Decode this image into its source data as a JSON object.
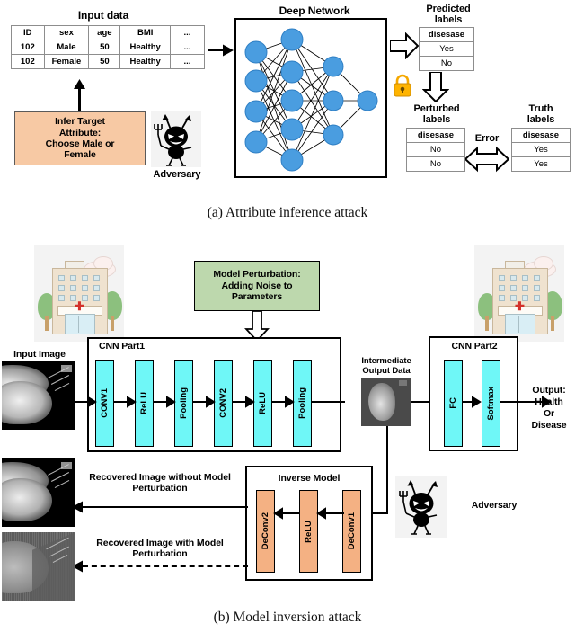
{
  "figure_a": {
    "caption": "(a) Attribute inference attack",
    "input_table": {
      "title": "Input data",
      "headers": [
        "ID",
        "sex",
        "age",
        "BMI",
        "..."
      ],
      "rows": [
        [
          "102",
          "Male",
          "50",
          "Healthy",
          "..."
        ],
        [
          "102",
          "Female",
          "50",
          "Healthy",
          "..."
        ]
      ],
      "highlight_color": "#ff0000"
    },
    "infer_box": {
      "line1": "Infer Target",
      "line2": "Attribute:",
      "line3": "Choose Male or",
      "line4": "Female",
      "fill": "#f7c9a4"
    },
    "adversary_label": "Adversary",
    "network": {
      "title": "Deep Network",
      "node_color": "#4a9de0",
      "layer_sizes": [
        4,
        5,
        3,
        1
      ]
    },
    "predicted": {
      "title_line1": "Predicted",
      "title_line2": "labels",
      "header": "disesase",
      "rows": [
        "Yes",
        "No"
      ]
    },
    "perturbed": {
      "title_line1": "Perturbed",
      "title_line2": "labels",
      "header": "disesase",
      "rows": [
        "No",
        "No"
      ]
    },
    "truth": {
      "title_line1": "Truth",
      "title_line2": "labels",
      "header": "disesase",
      "rows": [
        "Yes",
        "Yes"
      ]
    },
    "error_label": "Error",
    "lock_icon": "lock-icon"
  },
  "figure_b": {
    "caption": "(b) Model inversion attack",
    "hospital_a": "Hospital A",
    "hospital_b": "Hospital B",
    "perturbation_box": {
      "line1": "Model Perturbation:",
      "line2": "Adding Noise to",
      "line3": "Parameters",
      "fill": "#bdd8ad"
    },
    "input_image_label": "Input Image",
    "cnn_part1": {
      "title": "CNN Part1",
      "layers": [
        "CONV1",
        "ReLU",
        "Pooling",
        "CONV2",
        "ReLU",
        "Pooling"
      ],
      "fill": "#6ff7f7"
    },
    "intermediate": {
      "line1": "Intermediate",
      "line2": "Output Data"
    },
    "cnn_part2": {
      "title": "CNN Part2",
      "layers": [
        "FC",
        "Softmax"
      ],
      "fill": "#6ff7f7"
    },
    "output": {
      "line1": "Output:",
      "line2": "Health",
      "line3": "Or",
      "line4": "Disease"
    },
    "inverse_model": {
      "title": "Inverse Model",
      "layers": [
        "DeConv2",
        "ReLU",
        "DeConv1"
      ],
      "fill": "#f4b183"
    },
    "recovered_without": {
      "line1": "Recovered Image without Model",
      "line2": "Perturbation"
    },
    "recovered_with": {
      "line1": "Recovered Image with Model",
      "line2": "Perturbation"
    },
    "adversary_label": "Adversary"
  }
}
